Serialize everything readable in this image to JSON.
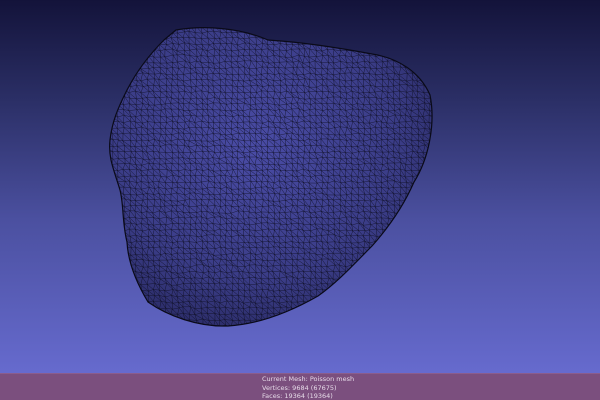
{
  "viewer": {
    "background_colors": [
      "#13133a",
      "#2b2f66",
      "#4b50a0",
      "#6b6fd6"
    ],
    "mesh_fill_color": "#3a3c86",
    "mesh_wire_color": "#0c0c1c"
  },
  "status": {
    "current_mesh": "Current Mesh: Poisson mesh",
    "vertices": "Vertices: 9684 (67675)",
    "faces": "Faces: 19364 (19364)"
  }
}
